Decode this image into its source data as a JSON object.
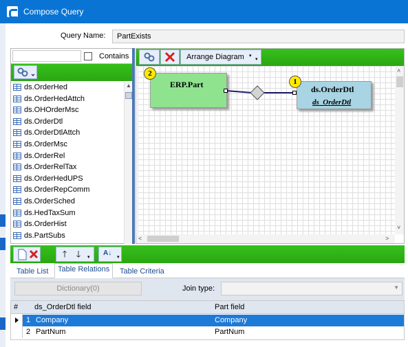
{
  "window": {
    "title": "Compose Query"
  },
  "query": {
    "label": "Query Name:",
    "value": "PartExists"
  },
  "search": {
    "value": "",
    "contains_label": "Contains",
    "contains_checked": false
  },
  "table_list": [
    "ds.OrderHed",
    "ds.OrderHedAttch",
    "ds.OHOrderMsc",
    "ds.OrderDtl",
    "ds.OrderDtlAttch",
    "ds.OrderMsc",
    "ds.OrderRel",
    "ds.OrderRelTax",
    "ds.OrderHedUPS",
    "ds.OrderRepComm",
    "ds.OrderSched",
    "ds.HedTaxSum",
    "ds.OrderHist",
    "ds.PartSubs"
  ],
  "diagram_toolbar": {
    "arrange_label": "Arrange Diagram"
  },
  "diagram": {
    "entity_part": {
      "badge": "2",
      "title": "ERP.Part"
    },
    "entity_dtl": {
      "badge": "1",
      "title": "ds.OrderDtl",
      "alias": "ds_OrderDtl"
    }
  },
  "tabs": [
    "Table List",
    "Table Relations",
    "Table Criteria"
  ],
  "active_tab": "Table Relations",
  "relations": {
    "dictionary_label": "Dictionary(0)",
    "join_type_label": "Join type:",
    "join_type_value": ""
  },
  "grid": {
    "columns": [
      "#",
      "ds_OrderDtl field",
      "Part field"
    ],
    "rows": [
      {
        "num": "1",
        "left": "Company",
        "right": "Company",
        "selected": true
      },
      {
        "num": "2",
        "left": "PartNum",
        "right": "PartNum",
        "selected": false
      }
    ]
  },
  "colors": {
    "titlebar": "#0a74d4",
    "toolbar_green": "#2aa711",
    "part_entity": "#8fe38f",
    "dtl_entity": "#a8d4e3",
    "selection": "#1e7ad7",
    "badge": "#ffea00"
  },
  "icons": {
    "app": "epicor-e-icon",
    "link": "link-icon",
    "delete": "red-x-icon",
    "new": "new-document-icon",
    "up": "arrow-up-icon",
    "down": "arrow-down-icon",
    "sort": "sort-az-icon"
  }
}
